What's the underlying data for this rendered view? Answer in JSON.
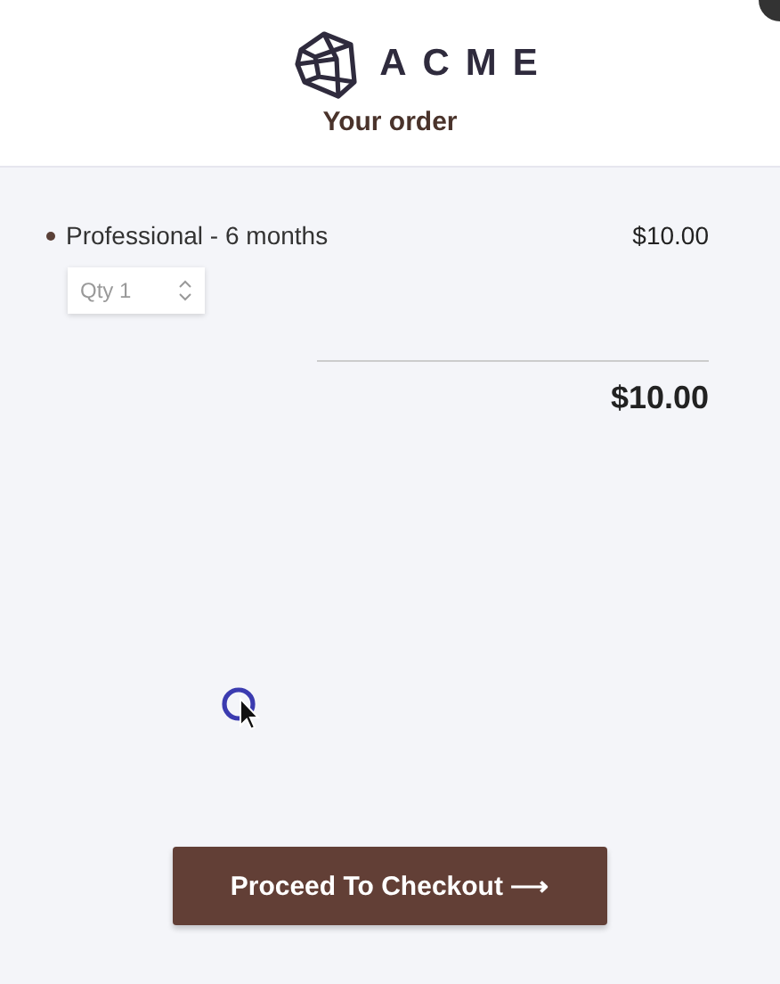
{
  "header": {
    "brand": "ACME",
    "title": "Your order"
  },
  "items": [
    {
      "name": "Professional - 6 months",
      "price": "$10.00",
      "quantity": "Qty 1"
    }
  ],
  "total": "$10.00",
  "checkout_button": {
    "label": "Proceed To Checkout ⟶"
  }
}
